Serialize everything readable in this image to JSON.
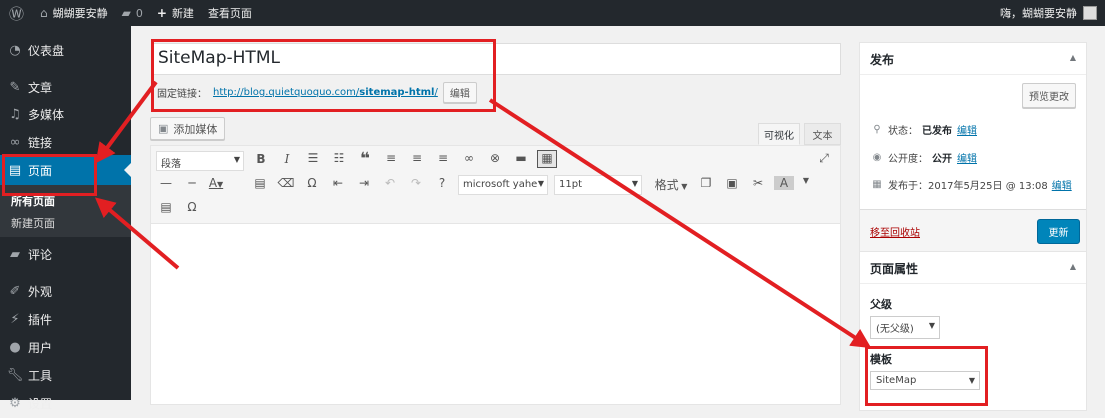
{
  "adminbar": {
    "site": "蝴蝴要安静",
    "comments": "0",
    "new": "新建",
    "view": "查看页面",
    "greeting": "嗨，蝴蝴要安静"
  },
  "sidebar": {
    "items": [
      {
        "label": "仪表盘",
        "icon": "dashboard-icon"
      },
      {
        "label": "文章",
        "icon": "pin-icon"
      },
      {
        "label": "多媒体",
        "icon": "media-icon"
      },
      {
        "label": "链接",
        "icon": "link-icon"
      },
      {
        "label": "页面",
        "icon": "page-icon"
      },
      {
        "label": "评论",
        "icon": "comment-icon"
      },
      {
        "label": "外观",
        "icon": "brush-icon"
      },
      {
        "label": "插件",
        "icon": "plugin-icon"
      },
      {
        "label": "用户",
        "icon": "user-icon"
      },
      {
        "label": "工具",
        "icon": "wrench-icon"
      },
      {
        "label": "设置",
        "icon": "settings-icon"
      }
    ],
    "submenu": [
      "所有页面",
      "新建页面"
    ]
  },
  "editor": {
    "title": "SiteMap-HTML",
    "permalink_label": "固定链接：",
    "permalink_base": "http://blog.quietquoquo.com/",
    "permalink_slug": "sitemap-html",
    "permalink_end": "/",
    "edit_btn": "编辑",
    "add_media": "添加媒体",
    "tab_visual": "可视化",
    "tab_text": "文本",
    "format": "段落",
    "font": "microsoft yahe",
    "size": "11pt",
    "formats": "格式"
  },
  "publish": {
    "title": "发布",
    "preview": "预览更改",
    "status_label": "状态：",
    "status_value": "已发布",
    "visibility_label": "公开度：",
    "visibility_value": "公开",
    "published_label": "发布于：",
    "published_value": "2017年5月25日 @ 13:08",
    "edit": "编辑",
    "trash": "移至回收站",
    "update": "更新"
  },
  "page_attributes": {
    "title": "页面属性",
    "parent_label": "父级",
    "parent_value": "(无父级)",
    "template_label": "模板",
    "template_value": "SiteMap"
  },
  "colors": {
    "accent": "#0073aa",
    "annotation": "#e21f22",
    "sidebar": "#23282d"
  }
}
